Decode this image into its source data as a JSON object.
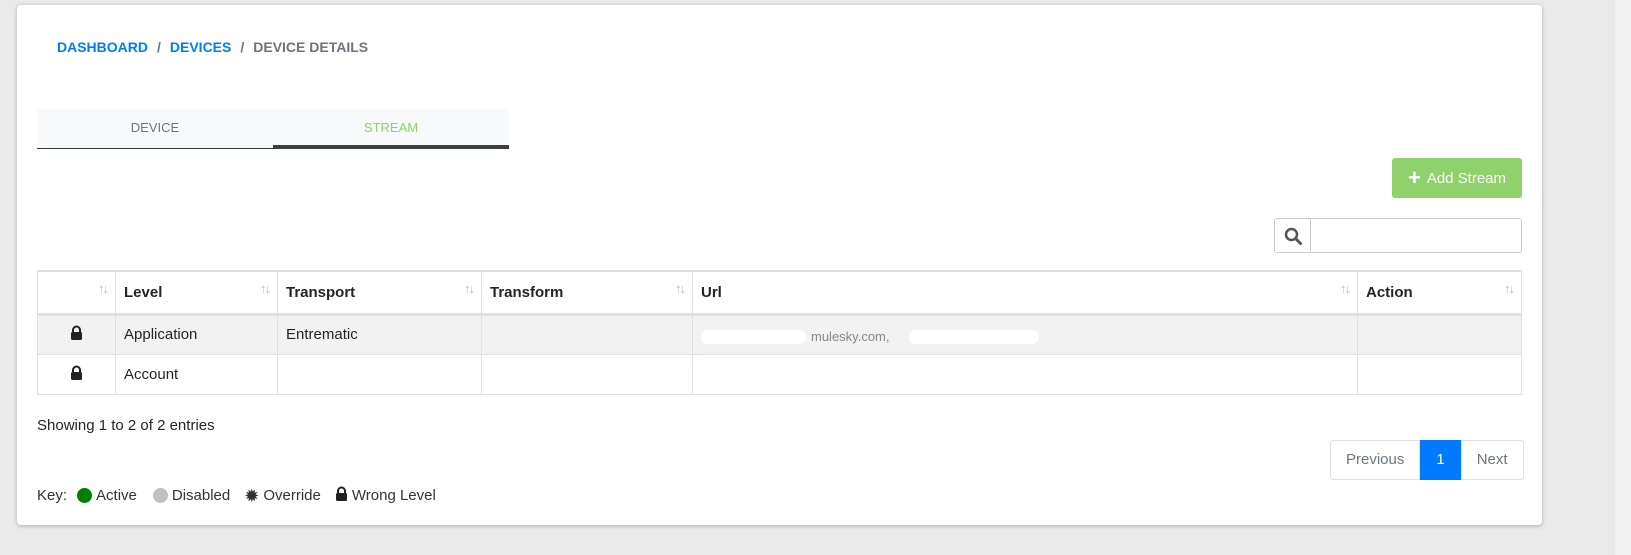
{
  "breadcrumb": {
    "items": [
      "DASHBOARD",
      "DEVICES"
    ],
    "current": "DEVICE DETAILS",
    "sep": "/"
  },
  "tabs": [
    {
      "label": "DEVICE"
    },
    {
      "label": "STREAM",
      "active": true
    }
  ],
  "add_button": {
    "label": "Add Stream",
    "icon": "plus-icon"
  },
  "search": {
    "value": "",
    "placeholder": "",
    "icon": "search-icon"
  },
  "table": {
    "columns": [
      "",
      "Level",
      "Transport",
      "Transform",
      "Url",
      "Action"
    ],
    "rows": [
      {
        "icon": "lock-icon",
        "level": "Application",
        "transport": "Entrematic",
        "transform": "",
        "url": "mulesky.com,",
        "action": ""
      },
      {
        "icon": "lock-icon",
        "level": "Account",
        "transport": "",
        "transform": "",
        "url": "",
        "action": ""
      }
    ]
  },
  "info": "Showing 1 to 2 of 2 entries",
  "pagination": {
    "previous": "Previous",
    "page": "1",
    "next": "Next"
  },
  "key": {
    "label": "Key:",
    "items": [
      {
        "label": "Active",
        "color": "#008000"
      },
      {
        "label": "Disabled",
        "color": "#c0c0c0"
      },
      {
        "label": "Override",
        "icon": "badge-icon"
      },
      {
        "label": "Wrong Level",
        "icon": "lock-icon"
      }
    ]
  },
  "colors": {
    "accent": "#007bff",
    "green": "#8fd16a"
  }
}
